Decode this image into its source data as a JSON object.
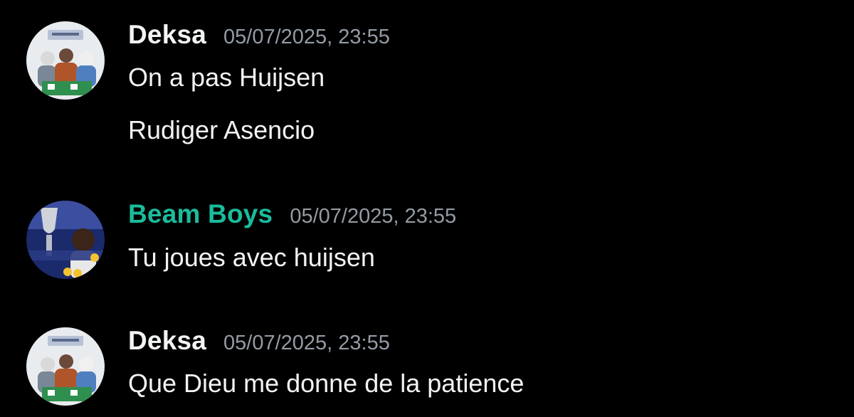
{
  "colors": {
    "background": "#000000",
    "username_default": "#f2f3f5",
    "username_beam": "#1abc9c",
    "timestamp": "#949ba4",
    "text": "#f2f3f5"
  },
  "messages": [
    {
      "author": "Deksa",
      "timestamp": "05/07/2025, 23:55",
      "avatar_icon": "user-avatar-icon",
      "lines": [
        "On a pas Huijsen",
        "Rudiger Asencio"
      ]
    },
    {
      "author": "Beam Boys",
      "timestamp": "05/07/2025, 23:55",
      "avatar_icon": "user-avatar-icon",
      "lines": [
        "Tu joues avec huijsen"
      ]
    },
    {
      "author": "Deksa",
      "timestamp": "05/07/2025, 23:55",
      "avatar_icon": "user-avatar-icon",
      "lines": [
        "Que Dieu me donne de la patience"
      ]
    }
  ]
}
